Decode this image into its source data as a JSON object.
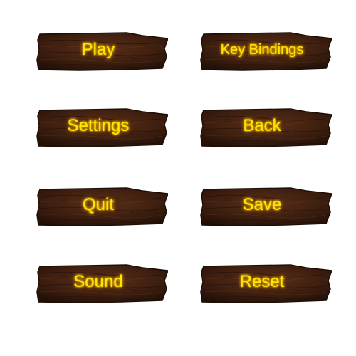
{
  "menu": {
    "buttons": [
      {
        "id": "play",
        "label": "Play"
      },
      {
        "id": "key-bindings",
        "label": "Key Bindings"
      },
      {
        "id": "settings",
        "label": "Settings"
      },
      {
        "id": "back",
        "label": "Back"
      },
      {
        "id": "quit",
        "label": "Quit"
      },
      {
        "id": "save",
        "label": "Save"
      },
      {
        "id": "sound",
        "label": "Sound"
      },
      {
        "id": "reset",
        "label": "Reset"
      }
    ]
  },
  "style": {
    "label_color": "#ffe600",
    "wood_dark": "#2a140a",
    "wood_mid": "#4a2614",
    "wood_light": "#6b3a1f",
    "background": "#ffffff"
  }
}
